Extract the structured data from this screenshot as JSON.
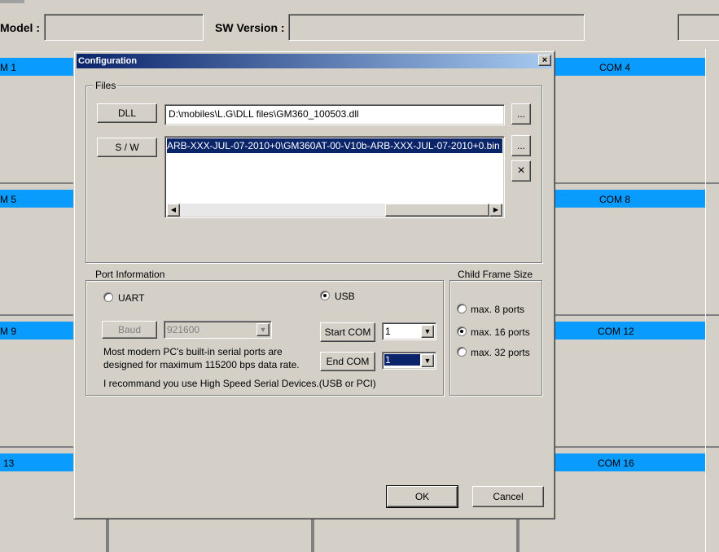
{
  "top_bar": {
    "model_label": "Model :",
    "model_value": "",
    "sw_version_label": "SW Version :",
    "sw_version_value": ""
  },
  "com_panes": [
    {
      "label": "M 1"
    },
    {
      "label": "COM 4"
    },
    {
      "label": "M 5"
    },
    {
      "label": "COM 8"
    },
    {
      "label": "M 9"
    },
    {
      "label": "COM 12"
    },
    {
      "label": "13"
    },
    {
      "label": "COM 16"
    }
  ],
  "dialog": {
    "title": "Configuration",
    "close_glyph": "×",
    "files": {
      "group_label": "Files",
      "dll_button": "DLL",
      "dll_path": "D:\\mobiles\\L.G\\DLL files\\GM360_100503.dll",
      "dll_browse": "...",
      "sw_button": "S / W",
      "sw_path": "ARB-XXX-JUL-07-2010+0\\GM360AT-00-V10b-ARB-XXX-JUL-07-2010+0.bin",
      "sw_browse": "...",
      "sw_remove": "×"
    },
    "port": {
      "group_label": "Port Information",
      "uart_label": "UART",
      "usb_label": "USB",
      "baud_button": "Baud",
      "baud_value": "921600",
      "start_com_label": "Start COM",
      "start_com_value": "1",
      "end_com_label": "End COM",
      "end_com_value": "1",
      "note_line1": "Most modern PC's built-in serial ports are",
      "note_line2": "designed for maximum 115200 bps data rate.",
      "recommend": "I recommand you use High Speed Serial Devices.(USB or PCI)"
    },
    "child_frame": {
      "group_label": "Child Frame Size",
      "opt8": "max. 8 ports",
      "opt16": "max. 16 ports",
      "opt32": "max. 32 ports"
    },
    "ok_label": "OK",
    "cancel_label": "Cancel"
  }
}
